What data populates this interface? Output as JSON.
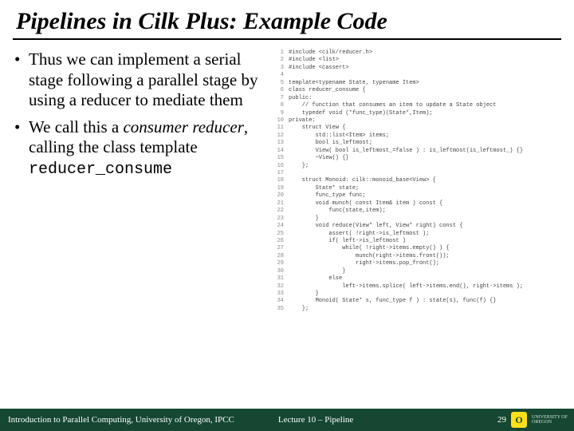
{
  "title": "Pipelines in Cilk Plus: Example Code",
  "bullets": [
    {
      "parts": [
        {
          "text": "Thus we can implement a serial stage following a parallel stage by using a reducer to mediate them"
        }
      ]
    },
    {
      "parts": [
        {
          "text": "We call this a "
        },
        {
          "text": "consumer reducer",
          "style": "ital"
        },
        {
          "text": ", calling the class template "
        },
        {
          "text": "reducer_consume",
          "style": "mono"
        }
      ]
    }
  ],
  "code": [
    "#include <cilk/reducer.h>",
    "#include <list>",
    "#include <cassert>",
    "",
    "template<typename State, typename Item>",
    "class reducer_consume {",
    "public:",
    "    // function that consumes an item to update a State object",
    "    typedef void (*func_type)(State*,Item);",
    "private:",
    "    struct View {",
    "        std::list<Item> items;",
    "        bool is_leftmost;",
    "        View( bool is_leftmost_=false ) : is_leftmost(is_leftmost_) {}",
    "        ~View() {}",
    "    };",
    "",
    "    struct Monoid: cilk::monoid_base<View> {",
    "        State* state;",
    "        func_type func;",
    "        void munch( const Item& item ) const {",
    "            func(state,item);",
    "        }",
    "        void reduce(View* left, View* right) const {",
    "            assert( !right->is_leftmost );",
    "            if( left->is_leftmost )",
    "                while( !right->items.empty() ) {",
    "                    munch(right->items.front());",
    "                    right->items.pop_front();",
    "                }",
    "            else",
    "                left->items.splice( left->items.end(), right->items );",
    "        }",
    "        Monoid( State* s, func_type f ) : state(s), func(f) {}",
    "    };"
  ],
  "footer": {
    "left": "Introduction to Parallel Computing, University of Oregon, IPCC",
    "center": "Lecture 10 – Pipeline",
    "page": "29",
    "org_line1": "UNIVERSITY OF",
    "org_line2": "OREGON",
    "logo_letter": "O"
  }
}
